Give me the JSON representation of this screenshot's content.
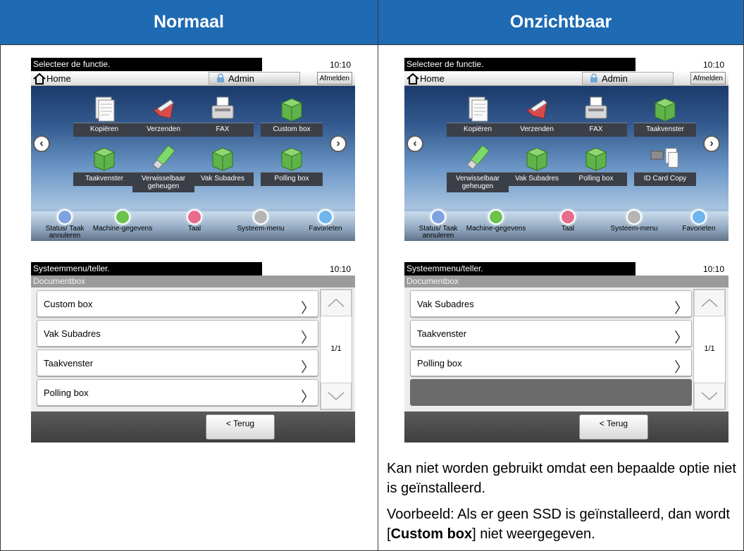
{
  "headers": {
    "left": "Normaal",
    "right": "Onzichtbaar"
  },
  "home": {
    "message": "Selecteer de functie.",
    "time": "10:10",
    "home_label": "Home",
    "user": "Admin",
    "logout": "Afmelden",
    "bottom": [
      "Status/ Taak annuleren",
      "Machine-gegevens",
      "Taal",
      "Systeem-menu",
      "Favorieten"
    ]
  },
  "home_left": {
    "functions": [
      "Kopiëren",
      "Verzenden",
      "FAX",
      "Custom box",
      "Taakvenster",
      "Verwisselbaar geheugen",
      "Vak Subadres",
      "Polling box"
    ]
  },
  "home_right": {
    "functions": [
      "Kopiëren",
      "Verzenden",
      "FAX",
      "Taakvenster",
      "Verwisselbaar geheugen",
      "Vak Subadres",
      "Polling box",
      "ID Card Copy"
    ]
  },
  "doc": {
    "message": "Systeemmenu/teller.",
    "time": "10:10",
    "subtitle": "Documentbox",
    "page": "1/1",
    "back": "< Terug"
  },
  "doc_left": {
    "rows": [
      "Custom box",
      "Vak Subadres",
      "Taakvenster",
      "Polling box"
    ]
  },
  "doc_right": {
    "rows": [
      "Vak Subadres",
      "Taakvenster",
      "Polling box"
    ]
  },
  "note": {
    "line1": "Kan niet worden gebruikt omdat een bepaalde optie niet is geïnstalleerd.",
    "line2_pre": "Voorbeeld: Als er geen SSD is geïnstalleerd, dan wordt [",
    "line2_bold": "Custom box",
    "line2_post": "] niet weergegeven."
  }
}
